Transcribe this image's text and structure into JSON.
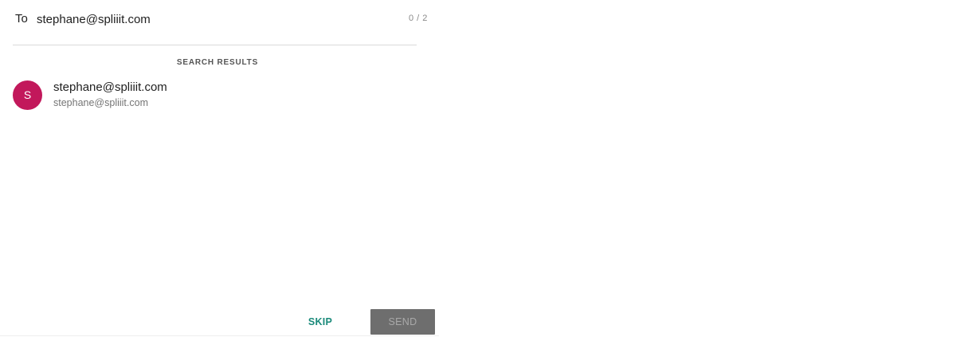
{
  "recipient_field": {
    "label": "To",
    "value": "stephane@spliiit.com",
    "placeholder": "",
    "counter": "0 / 2"
  },
  "search_results": {
    "title": "SEARCH RESULTS",
    "items": [
      {
        "avatar_initial": "S",
        "avatar_color": "#c2185b",
        "primary": "stephane@spliiit.com",
        "secondary": "stephane@spliiit.com"
      }
    ]
  },
  "actions": {
    "skip_label": "SKIP",
    "send_label": "SEND",
    "send_enabled": false,
    "accent_color": "#1a8a7a"
  }
}
